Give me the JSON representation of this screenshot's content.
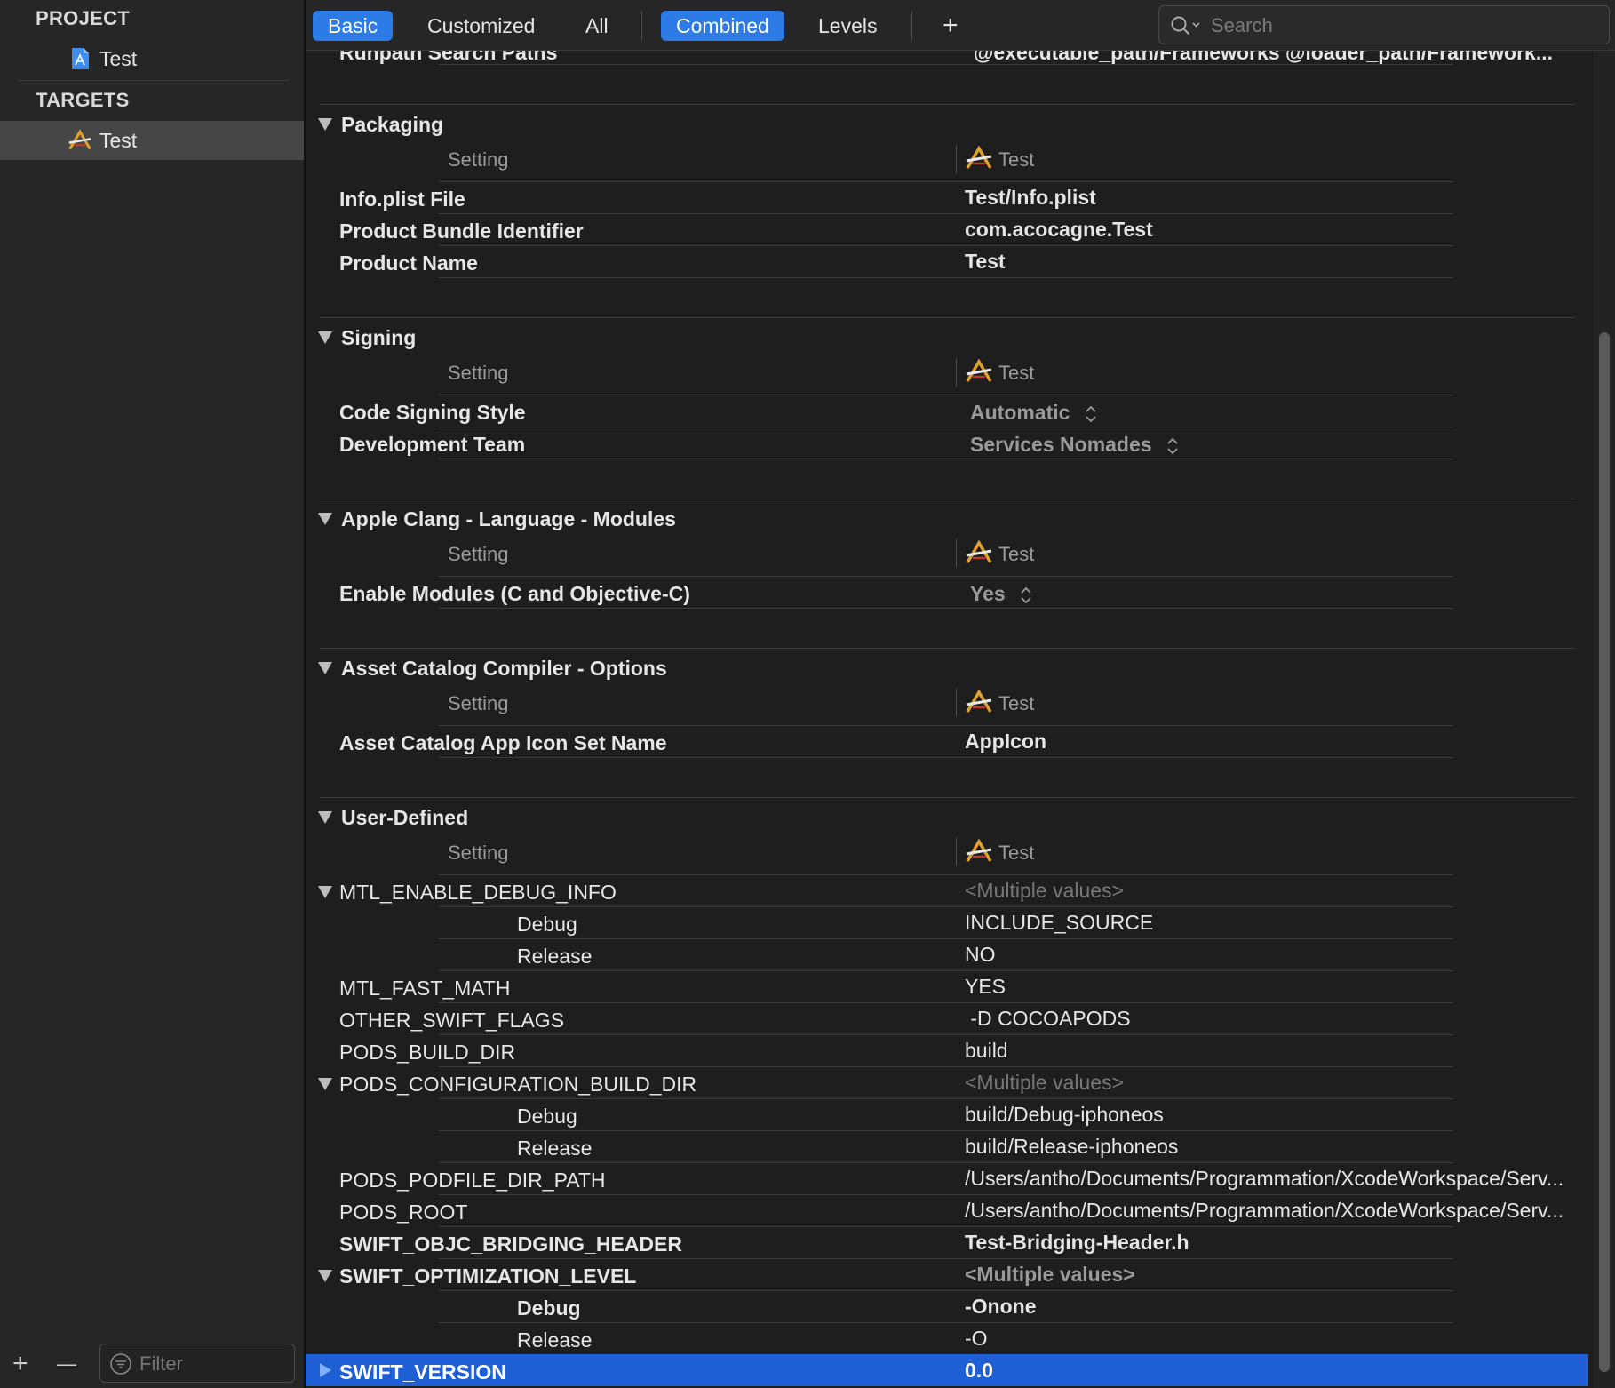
{
  "sidebar": {
    "project_header": "PROJECT",
    "project_item": "Test",
    "targets_header": "TARGETS",
    "target_item": "Test",
    "filter_placeholder": "Filter",
    "add_label": "+",
    "remove_label": "—"
  },
  "toolbar": {
    "tabs": [
      "Basic",
      "Customized",
      "All"
    ],
    "views": [
      "Combined",
      "Levels"
    ],
    "add_label": "+",
    "search_placeholder": "Search"
  },
  "partial_row": {
    "label": "Runpath Search Paths",
    "value": "@executable_path/Frameworks @loader_path/Framework..."
  },
  "column_headers": {
    "setting": "Setting",
    "target": "Test"
  },
  "groups": {
    "packaging": {
      "title": "Packaging",
      "rows": [
        {
          "label": "Info.plist File",
          "value": "Test/Info.plist"
        },
        {
          "label": "Product Bundle Identifier",
          "value": "com.acocagne.Test"
        },
        {
          "label": "Product Name",
          "value": "Test"
        }
      ]
    },
    "signing": {
      "title": "Signing",
      "rows": [
        {
          "label": "Code Signing Style",
          "value": "Automatic"
        },
        {
          "label": "Development Team",
          "value": "Services Nomades"
        }
      ]
    },
    "clang": {
      "title": "Apple Clang - Language - Modules",
      "rows": [
        {
          "label": "Enable Modules (C and Objective-C)",
          "value": "Yes"
        }
      ]
    },
    "asset": {
      "title": "Asset Catalog Compiler - Options",
      "rows": [
        {
          "label": "Asset Catalog App Icon Set Name",
          "value": "AppIcon"
        }
      ]
    },
    "user": {
      "title": "User-Defined",
      "rows": [
        {
          "label": "MTL_ENABLE_DEBUG_INFO",
          "value": "<Multiple values>"
        },
        {
          "label": "Debug",
          "value": "INCLUDE_SOURCE"
        },
        {
          "label": "Release",
          "value": "NO"
        },
        {
          "label": "MTL_FAST_MATH",
          "value": "YES"
        },
        {
          "label": "OTHER_SWIFT_FLAGS",
          "value": " -D COCOAPODS"
        },
        {
          "label": "PODS_BUILD_DIR",
          "value": "build"
        },
        {
          "label": "PODS_CONFIGURATION_BUILD_DIR",
          "value": "<Multiple values>"
        },
        {
          "label": "Debug",
          "value": "build/Debug-iphoneos"
        },
        {
          "label": "Release",
          "value": "build/Release-iphoneos"
        },
        {
          "label": "PODS_PODFILE_DIR_PATH",
          "value": "/Users/antho/Documents/Programmation/XcodeWorkspace/Serv..."
        },
        {
          "label": "PODS_ROOT",
          "value": "/Users/antho/Documents/Programmation/XcodeWorkspace/Serv..."
        },
        {
          "label": "SWIFT_OBJC_BRIDGING_HEADER",
          "value": "Test-Bridging-Header.h"
        },
        {
          "label": "SWIFT_OPTIMIZATION_LEVEL",
          "value": "<Multiple values>"
        },
        {
          "label": "Debug",
          "value": "-Onone"
        },
        {
          "label": "Release",
          "value": "-O"
        },
        {
          "label": "SWIFT_VERSION",
          "value": "0.0"
        }
      ]
    }
  },
  "colors": {
    "accent": "#2d7be6",
    "selection": "#1f5fd6",
    "background": "#1e1e1e"
  }
}
